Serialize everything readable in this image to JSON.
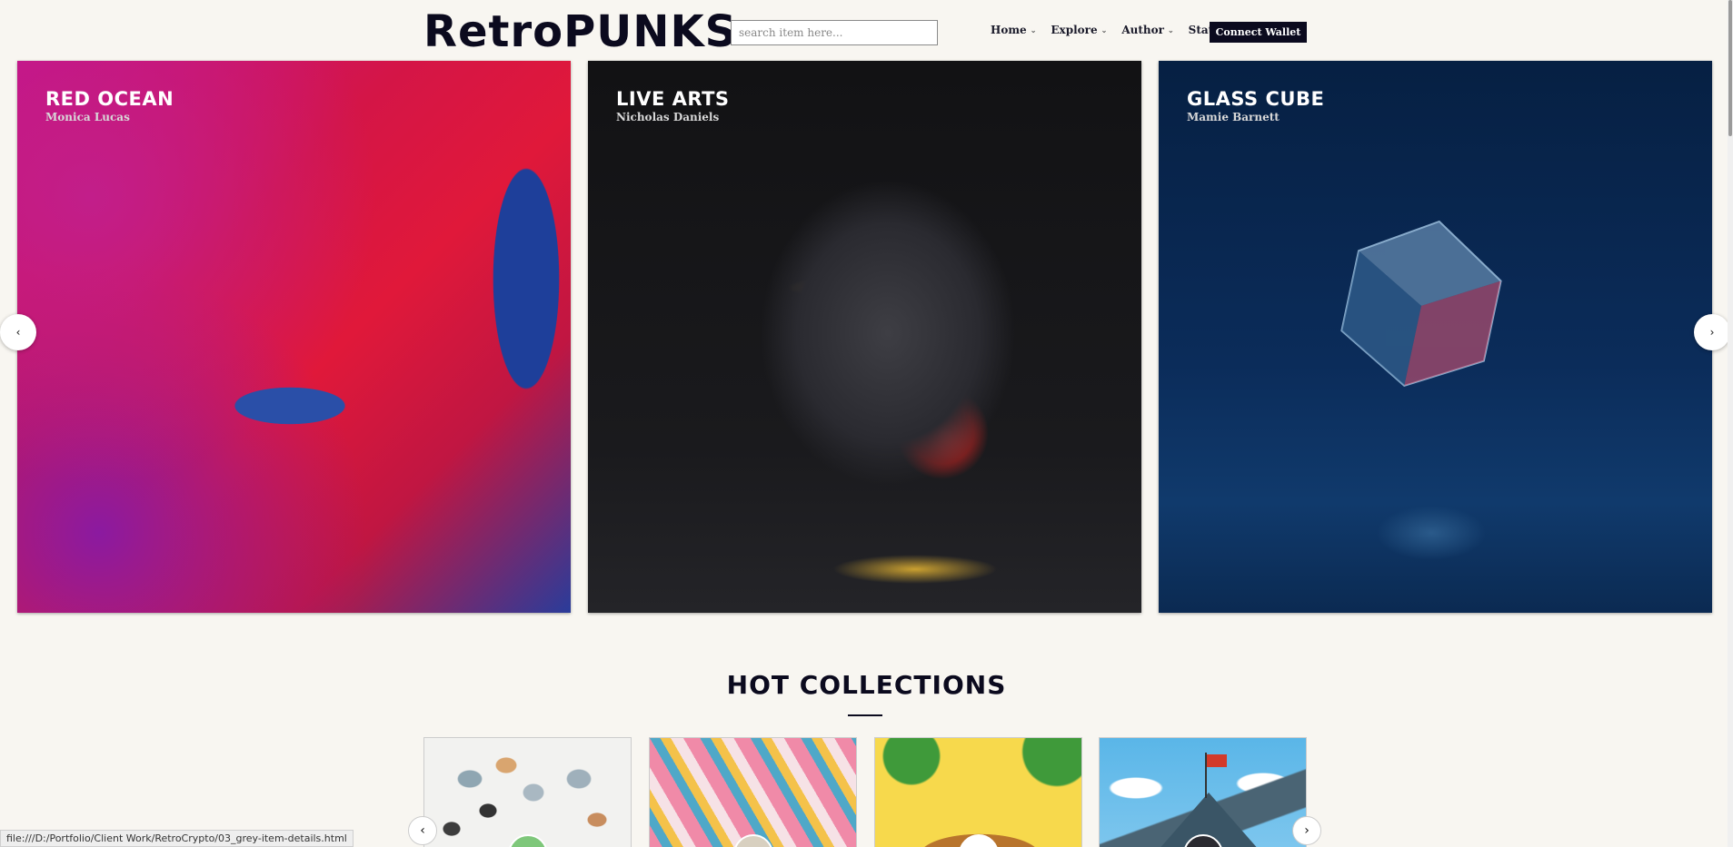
{
  "header": {
    "logo": "RetroPUNKS",
    "search_placeholder": "search item here...",
    "nav": [
      {
        "label": "Home"
      },
      {
        "label": "Explore"
      },
      {
        "label": "Author"
      },
      {
        "label": "Stats"
      }
    ],
    "wallet_label": "Connect Wallet"
  },
  "carousel": {
    "slides": [
      {
        "title": "RED OCEAN",
        "author": "Monica Lucas"
      },
      {
        "title": "LIVE ARTS",
        "author": "Nicholas Daniels"
      },
      {
        "title": "GLASS CUBE",
        "author": "Mamie Barnett"
      }
    ],
    "prev_icon": "‹",
    "next_icon": "›"
  },
  "hot_collections": {
    "title": "HOT COLLECTIONS",
    "prev_icon": "‹",
    "next_icon": "›"
  },
  "statusbar": {
    "url": "file:///D:/Portfolio/Client Work/RetroCrypto/03_grey-item-details.html"
  }
}
